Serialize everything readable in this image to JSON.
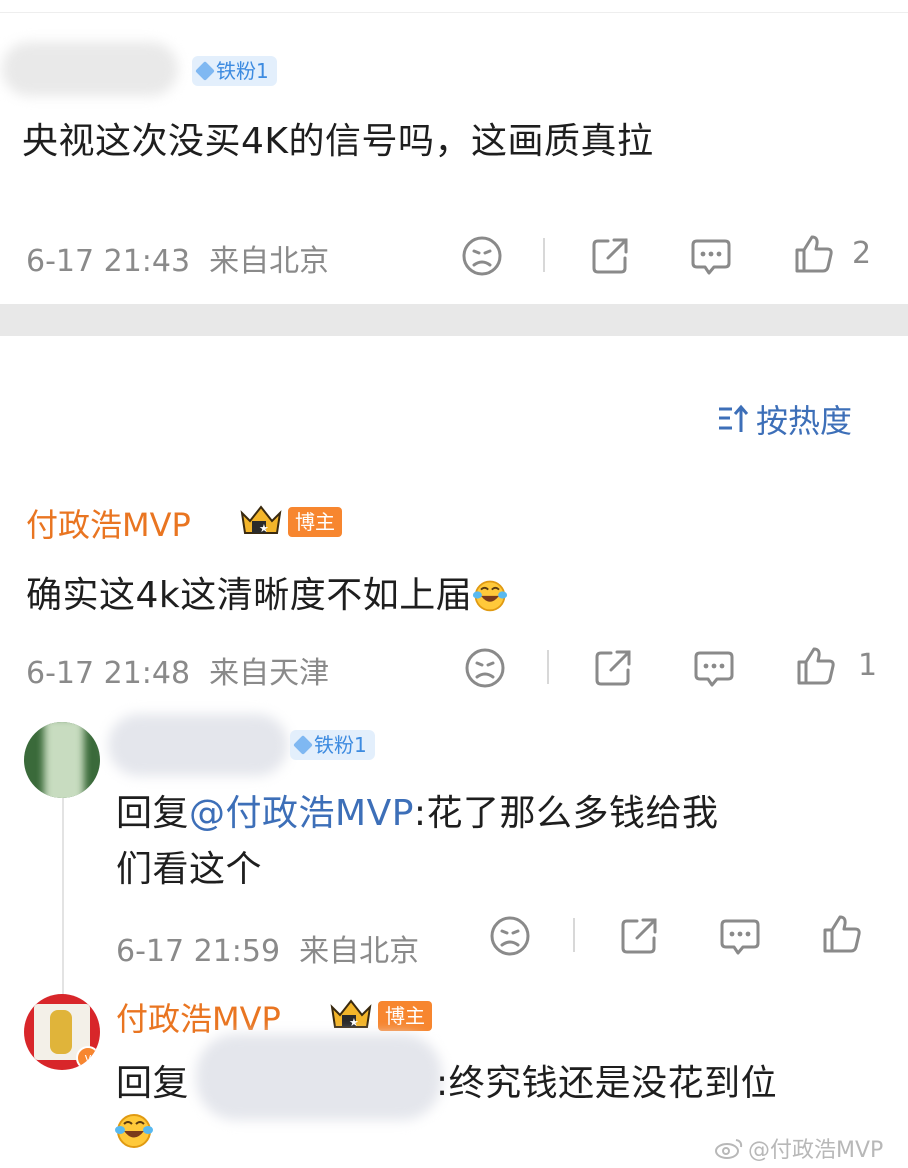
{
  "first_comment": {
    "badge": "铁粉1",
    "text": "央视这次没买4K的信号吗，这画质真拉",
    "time": "6-17 21:43",
    "location": "来自北京",
    "like_count": "2"
  },
  "sort": {
    "label": "按热度"
  },
  "comment2": {
    "user": "付政浩MVP",
    "badge": "博主",
    "text": "确实这4k这清晰度不如上届",
    "time": "6-17 21:48",
    "location": "来自天津",
    "like_count": "1"
  },
  "reply1": {
    "badge": "铁粉1",
    "prefix": "回复",
    "mention": "@付政浩MVP",
    "line1": ":花了那么多钱给我",
    "line2": "们看这个",
    "time": "6-17 21:59",
    "location": "来自北京"
  },
  "reply2": {
    "user": "付政浩MVP",
    "badge": "博主",
    "prefix": "回复",
    "text": ":终究钱还是没花到位"
  },
  "watermark": "@付政浩MVP",
  "colors": {
    "orange": "#e97521",
    "link": "#3d6fb8",
    "gray": "#8a8a8a",
    "divider": "#e8e8e8"
  }
}
